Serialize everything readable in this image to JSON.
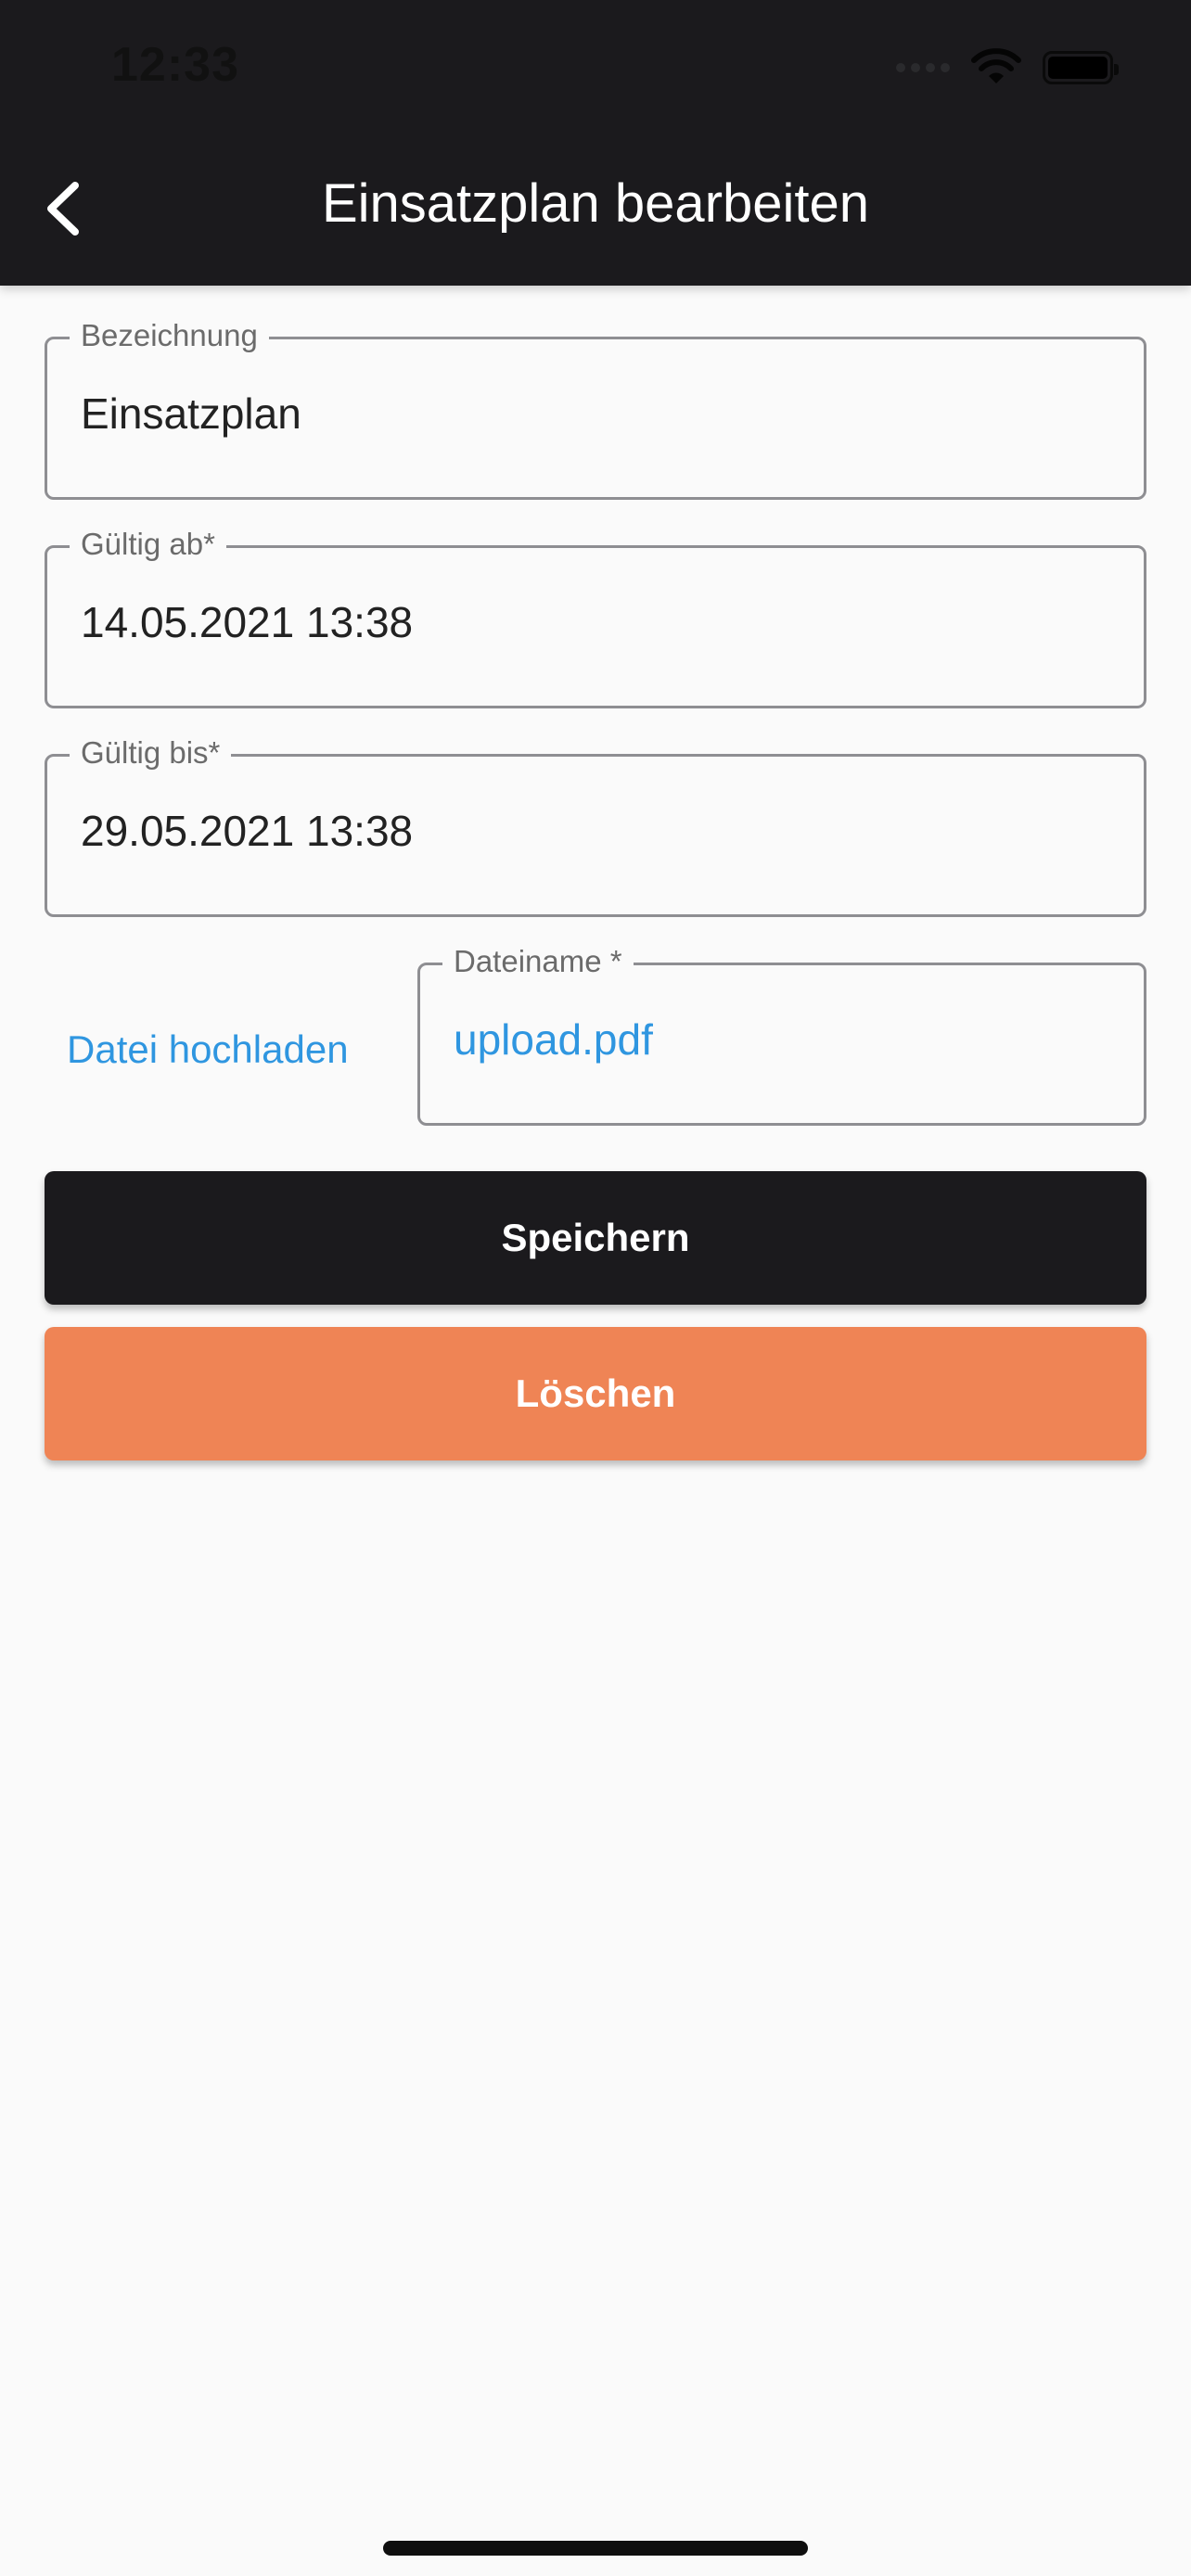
{
  "status_bar": {
    "time": "12:33",
    "icons": [
      "signal-icon",
      "wifi-icon",
      "battery-icon"
    ]
  },
  "app_bar": {
    "title": "Einsatzplan bearbeiten",
    "back_icon": "chevron-left-icon"
  },
  "form": {
    "bezeichnung": {
      "label": "Bezeichnung",
      "value": "Einsatzplan"
    },
    "gueltig_ab": {
      "label": "Gültig ab*",
      "value": "14.05.2021 13:38"
    },
    "gueltig_bis": {
      "label": "Gültig bis*",
      "value": "29.05.2021 13:38"
    },
    "upload_label": "Datei hochladen",
    "dateiname": {
      "label": "Dateiname *",
      "value": "upload.pdf"
    }
  },
  "buttons": {
    "save": "Speichern",
    "delete": "Löschen"
  },
  "colors": {
    "app_bar": "#1b1a1d",
    "background": "#fafafa",
    "link": "#2f96e0",
    "save_button": "#1b1a1d",
    "delete_button": "#ef8455"
  }
}
